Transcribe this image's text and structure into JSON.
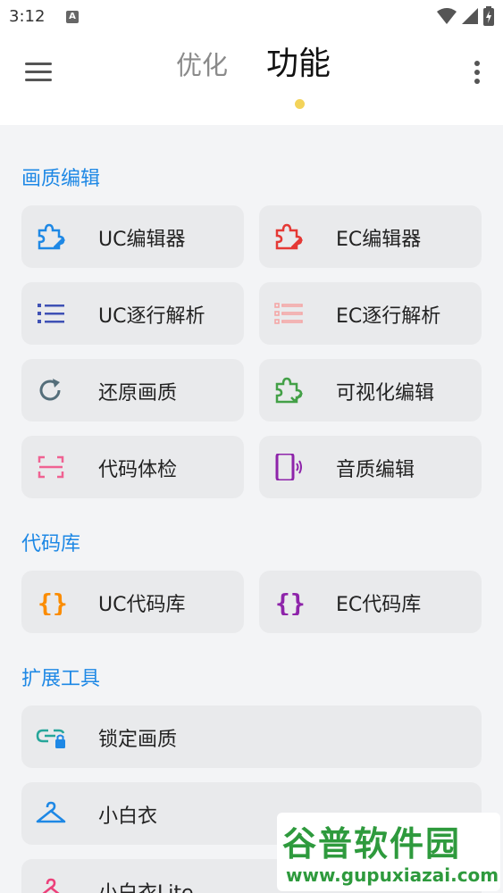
{
  "status_bar": {
    "time": "3:12",
    "notif_badge": "A"
  },
  "header": {
    "tab_inactive": "优化",
    "tab_active": "功能",
    "accent": "#f3d35a"
  },
  "sections": {
    "s1": "画质编辑",
    "s2": "代码库",
    "s3": "扩展工具"
  },
  "items": {
    "uc_editor": "UC编辑器",
    "ec_editor": "EC编辑器",
    "uc_parse": "UC逐行解析",
    "ec_parse": "EC逐行解析",
    "restore": "还原画质",
    "visual_edit": "可视化编辑",
    "code_check": "代码体检",
    "sound_edit": "音质编辑",
    "uc_lib": "UC代码库",
    "ec_lib": "EC代码库",
    "lock_quality": "锁定画质",
    "xiaobaiyi": "小白衣",
    "xiaobaiyi_lite": "小白衣Lite"
  },
  "watermark": {
    "title": "谷普软件园",
    "url": "www.gupuxiazai.com"
  },
  "colors": {
    "section_title": "#1e88e5",
    "card_bg": "#e9eaec"
  }
}
